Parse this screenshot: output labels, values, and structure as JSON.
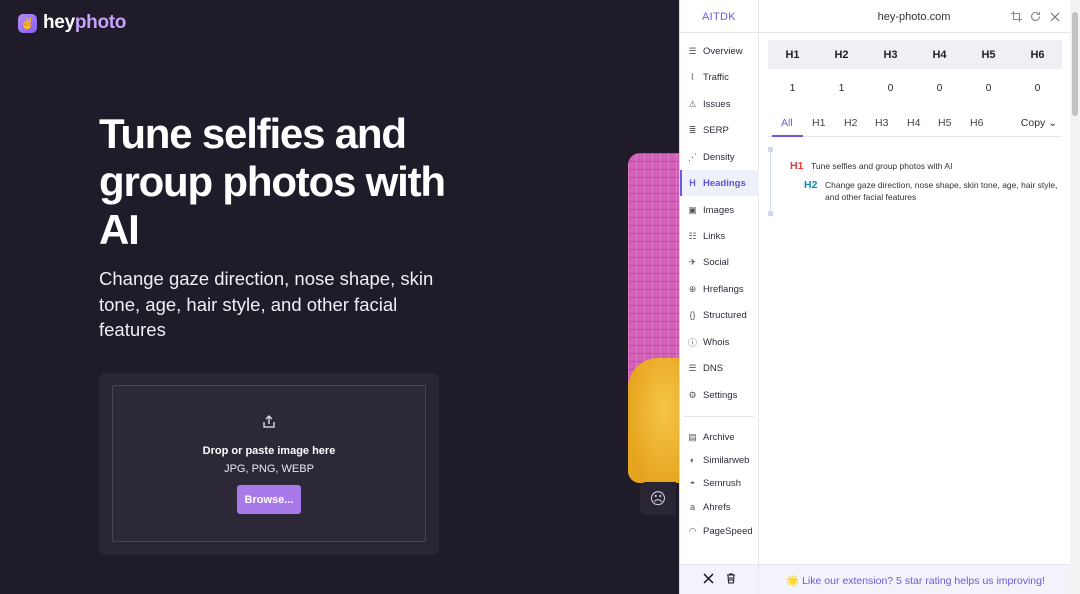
{
  "site": {
    "logo_mark": "✌",
    "logo_text_a": "hey",
    "logo_text_b": "photo",
    "title": "Tune selfies and group photos with AI",
    "subtitle": "Change gaze direction, nose shape, skin tone, age, hair style, and other facial features",
    "upload": {
      "icon": "upload-icon",
      "line1": "Drop or paste image here",
      "line2": "JPG, PNG, WEBP",
      "button": "Browse..."
    },
    "face_icon": "☹"
  },
  "extension": {
    "brand": "AITDK",
    "domain": "hey-photo.com",
    "top_icons": [
      "crop-icon",
      "refresh-icon",
      "close-icon"
    ],
    "nav": [
      {
        "label": "Overview",
        "icon": "list-icon",
        "glyph": "☰"
      },
      {
        "label": "Traffic",
        "icon": "chart-line-icon",
        "glyph": "⌇"
      },
      {
        "label": "Issues",
        "icon": "warning-icon",
        "glyph": "⚠"
      },
      {
        "label": "SERP",
        "icon": "serp-icon",
        "glyph": "≣"
      },
      {
        "label": "Density",
        "icon": "density-icon",
        "glyph": "⋰"
      },
      {
        "label": "Headings",
        "icon": "heading-icon",
        "glyph": "H"
      },
      {
        "label": "Images",
        "icon": "image-icon",
        "glyph": "▣"
      },
      {
        "label": "Links",
        "icon": "links-icon",
        "glyph": "☷"
      },
      {
        "label": "Social",
        "icon": "twitter-bird-icon",
        "glyph": "✈"
      },
      {
        "label": "Hreflangs",
        "icon": "globe-icon",
        "glyph": "⊕"
      },
      {
        "label": "Structured",
        "icon": "braces-icon",
        "glyph": "{}"
      },
      {
        "label": "Whois",
        "icon": "info-icon",
        "glyph": "ⓘ"
      },
      {
        "label": "DNS",
        "icon": "server-icon",
        "glyph": "☰"
      },
      {
        "label": "Settings",
        "icon": "gear-icon",
        "glyph": "⚙"
      },
      {
        "label": "Archive",
        "icon": "archive-icon",
        "glyph": "▤"
      },
      {
        "label": "Similarweb",
        "icon": "similarweb-icon",
        "glyph": "◐"
      },
      {
        "label": "Semrush",
        "icon": "semrush-icon",
        "glyph": "◓"
      },
      {
        "label": "Ahrefs",
        "icon": "ahrefs-icon",
        "glyph": "a"
      },
      {
        "label": "PageSpeed",
        "icon": "speed-icon",
        "glyph": "◠"
      }
    ],
    "active_nav": "Headings",
    "headings_table": {
      "headers": [
        "H1",
        "H2",
        "H3",
        "H4",
        "H5",
        "H6"
      ],
      "counts": [
        "1",
        "1",
        "0",
        "0",
        "0",
        "0"
      ]
    },
    "tabs": [
      "All",
      "H1",
      "H2",
      "H3",
      "H4",
      "H5",
      "H6"
    ],
    "active_tab": "All",
    "copy_label": "Copy ⌄",
    "headings": [
      {
        "level": "H1",
        "text": "Tune selfies and group photos with AI",
        "color": "#e53935"
      },
      {
        "level": "H2",
        "text": "Change gaze direction, nose shape, skin tone, age, hair style, and other facial features",
        "color": "#0b8bb5"
      }
    ],
    "bottom_icons": [
      "x-logo-icon",
      "trash-icon"
    ],
    "rating_text": "🌟 Like our extension? 5 star rating helps us improving!"
  }
}
